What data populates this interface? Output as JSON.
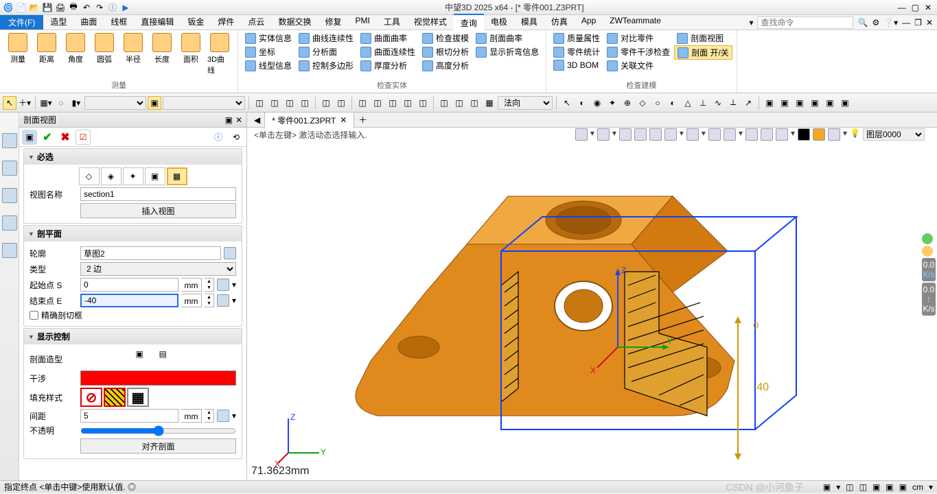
{
  "title": "中望3D 2025 x64 - [* 零件001.Z3PRT]",
  "qat_icons": [
    "app-icon",
    "new-icon",
    "open-icon",
    "save-icon",
    "print-icon",
    "print-preview-icon",
    "undo-icon",
    "redo-icon",
    "help-icon",
    "play-icon"
  ],
  "menu": {
    "file": "文件(F)",
    "tabs": [
      "造型",
      "曲面",
      "线框",
      "直接编辑",
      "钣金",
      "焊件",
      "点云",
      "数据交换",
      "修复",
      "PMI",
      "工具",
      "视觉样式",
      "查询",
      "电极",
      "模具",
      "仿真",
      "App",
      "ZWTeammate"
    ],
    "active": "查询",
    "search_ph": "查找命令"
  },
  "ribbon": {
    "g1": {
      "label": "测量",
      "big": [
        {
          "l": "测量"
        },
        {
          "l": "距离"
        },
        {
          "l": "角度"
        },
        {
          "l": "圆弧"
        },
        {
          "l": "半径"
        },
        {
          "l": "长度"
        },
        {
          "l": "面积"
        },
        {
          "l": "3D曲线"
        }
      ]
    },
    "g2": {
      "label": "检查实体",
      "cols": [
        [
          "实体信息",
          "坐标",
          "线型信息"
        ],
        [
          "曲线连续性",
          "分析面",
          "控制多边形"
        ],
        [
          "曲面曲率",
          "曲面连续性",
          "厚度分析"
        ],
        [
          "检查拔模",
          "根切分析",
          "高度分析"
        ],
        [
          "剖面曲率",
          "显示折弯信息"
        ]
      ]
    },
    "g3": {
      "label": "检查建模",
      "cols": [
        [
          "质量属性",
          "零件统计",
          "3D BOM"
        ],
        [
          "对比零件",
          "零件干涉检查",
          "关联文件"
        ],
        [
          "剖面视图",
          "剖面 开/关"
        ]
      ],
      "highlight": "剖面 开/关"
    }
  },
  "tb2": {
    "dir": "法向"
  },
  "panel": {
    "title": "剖面视图",
    "s1": {
      "h": "必选",
      "view_name_l": "视图名称",
      "view_name": "section1",
      "insert_btn": "插入视图"
    },
    "s2": {
      "h": "剖平面",
      "profile_l": "轮廓",
      "profile": "草图2",
      "type_l": "类型",
      "type": "2 边",
      "start_l": "起始点 S",
      "start": "0",
      "end_l": "结束点 E",
      "end": "-40",
      "unit": "mm",
      "precise": "精确剖切框"
    },
    "s3": {
      "h": "显示控制",
      "style_l": "剖面造型",
      "interf_l": "干涉",
      "fill_l": "填充样式",
      "gap_l": "间距",
      "gap": "5",
      "opacity_l": "不透明",
      "align_btn": "对齐剖面"
    }
  },
  "doc": {
    "tab": "* 零件001.Z3PRT",
    "hint": "<单击左键> 激活动态选择输入.",
    "layer": "图层0000"
  },
  "canvas": {
    "measure": "71.3623mm",
    "dim": "-40",
    "zero": "0"
  },
  "status": {
    "left": "指定终点  <单击中键>使用默认值. ◎",
    "speed1": "0.0",
    "unit1": "K/s",
    "speed2": "0.0",
    "unit2": "K/s"
  },
  "watermark": "CSDN @小河鱼子"
}
